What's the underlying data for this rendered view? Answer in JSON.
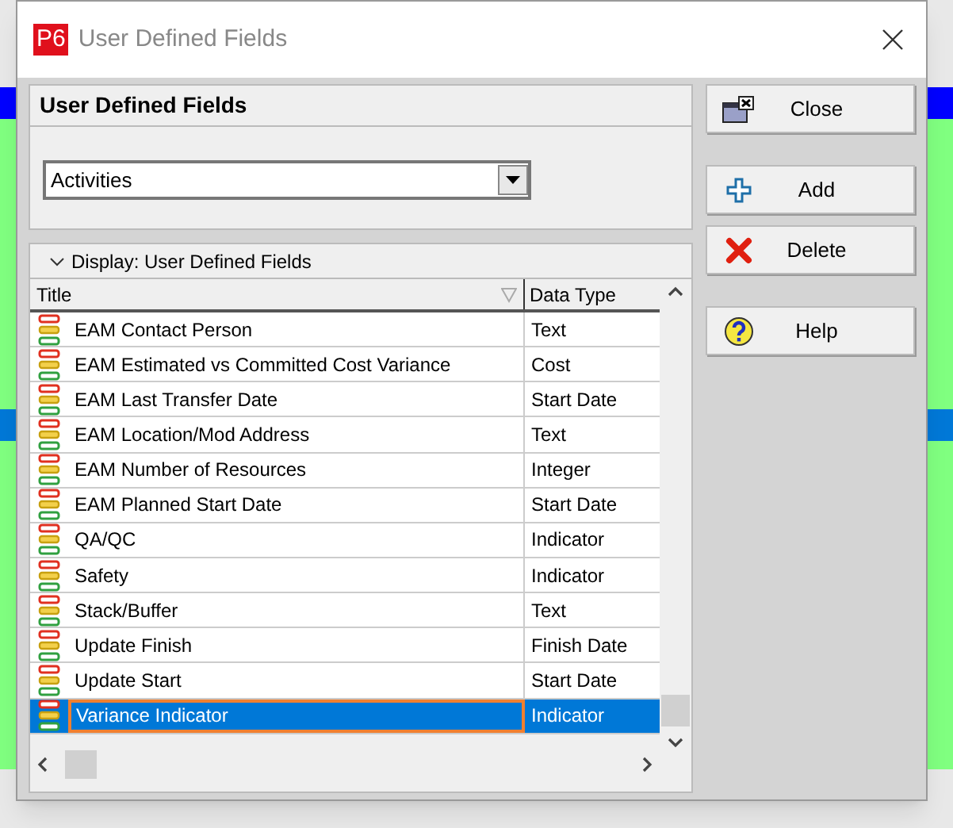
{
  "window": {
    "title": "User Defined Fields",
    "logo": "P6"
  },
  "panel": {
    "title": "User Defined Fields"
  },
  "subject_area": {
    "value": "Activities"
  },
  "display": {
    "title": "Display: User Defined Fields",
    "expanded": true
  },
  "table": {
    "columns": [
      "Title",
      "Data Type"
    ],
    "rows": [
      {
        "title": "EAM Contact Person",
        "data_type": "Text",
        "selected": false
      },
      {
        "title": "EAM Estimated vs Committed Cost Variance",
        "data_type": "Cost",
        "selected": false
      },
      {
        "title": "EAM Last Transfer Date",
        "data_type": "Start Date",
        "selected": false
      },
      {
        "title": "EAM Location/Mod Address",
        "data_type": "Text",
        "selected": false
      },
      {
        "title": "EAM Number of Resources",
        "data_type": "Integer",
        "selected": false
      },
      {
        "title": "EAM Planned Start Date",
        "data_type": "Start Date",
        "selected": false
      },
      {
        "title": "QA/QC",
        "data_type": "Indicator",
        "selected": false
      },
      {
        "title": "Safety",
        "data_type": "Indicator",
        "selected": false
      },
      {
        "title": "Stack/Buffer",
        "data_type": "Text",
        "selected": false
      },
      {
        "title": "Update Finish",
        "data_type": "Finish Date",
        "selected": false
      },
      {
        "title": "Update Start",
        "data_type": "Start Date",
        "selected": false
      },
      {
        "title": "Variance Indicator",
        "data_type": "Indicator",
        "selected": true
      }
    ]
  },
  "buttons": [
    {
      "kind": "close",
      "label": "Close"
    },
    {
      "kind": "add",
      "label": "Add"
    },
    {
      "kind": "delete",
      "label": "Delete"
    },
    {
      "kind": "help",
      "label": "Help"
    }
  ]
}
